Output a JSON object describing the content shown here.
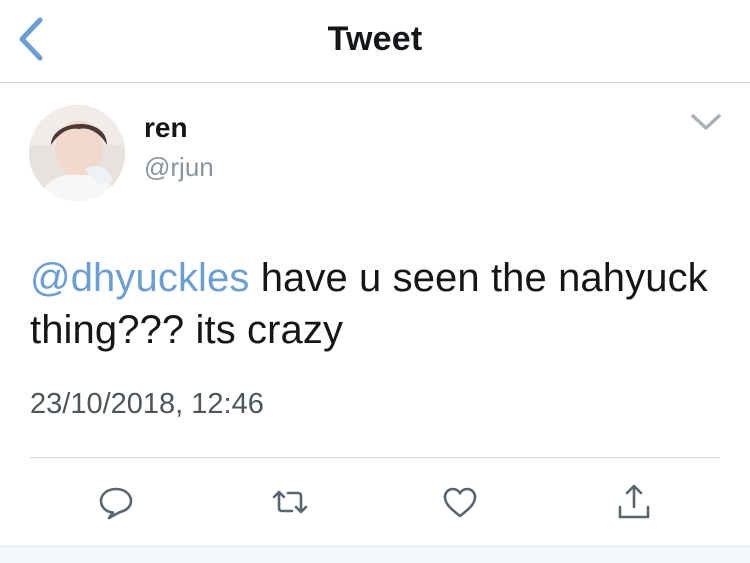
{
  "header": {
    "title": "Tweet",
    "back_icon": "chevron-left-icon"
  },
  "colors": {
    "accent": "#6a9fd4",
    "text": "#14171a",
    "muted": "#8a949c",
    "icon": "#5a666f"
  },
  "tweet": {
    "author": {
      "display_name": "ren",
      "handle": "@rjun"
    },
    "mention": "@dhyuckles",
    "body_rest": " have u seen the nahyuck thing??? its crazy",
    "timestamp": "23/10/2018, 12:46"
  },
  "actions": [
    {
      "name": "reply",
      "icon": "comment-icon"
    },
    {
      "name": "retweet",
      "icon": "retweet-icon"
    },
    {
      "name": "like",
      "icon": "heart-icon"
    },
    {
      "name": "share",
      "icon": "share-icon"
    }
  ]
}
